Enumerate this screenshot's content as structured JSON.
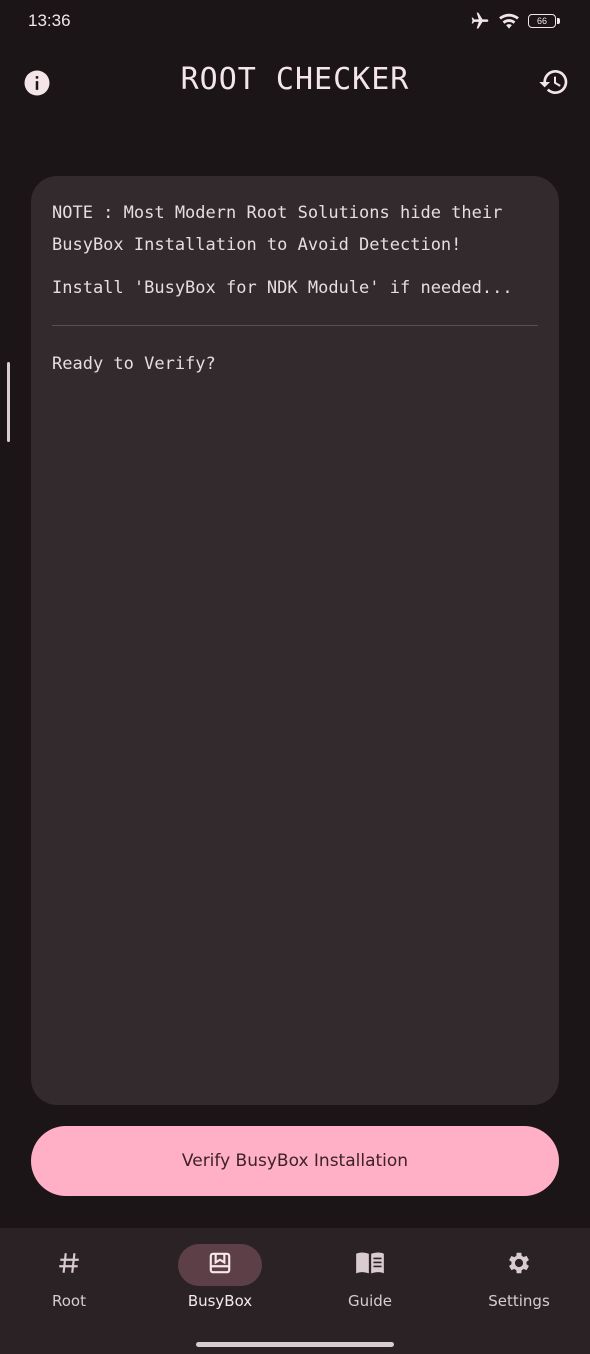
{
  "status_bar": {
    "time": "13:36",
    "icons": [
      "airplane-icon",
      "wifi-icon",
      "battery-icon"
    ],
    "battery_level": "66"
  },
  "app_bar": {
    "title": "ROOT CHECKER",
    "left_icon": "info-icon",
    "right_icon": "history-icon"
  },
  "card": {
    "note": "NOTE : Most Modern Root Solutions hide their BusyBox Installation to Avoid Detection!",
    "install_hint": "Install 'BusyBox for NDK Module' if needed...",
    "status": "Ready to Verify?"
  },
  "verify_button": {
    "label": "Verify BusyBox Installation"
  },
  "bottom_nav": {
    "items": [
      {
        "label": "Root",
        "icon": "hash-icon",
        "active": false
      },
      {
        "label": "BusyBox",
        "icon": "bookmark-box-icon",
        "active": true
      },
      {
        "label": "Guide",
        "icon": "book-open-icon",
        "active": false
      },
      {
        "label": "Settings",
        "icon": "gear-icon",
        "active": false
      }
    ]
  },
  "colors": {
    "background": "#1c1517",
    "card": "#322a2c",
    "accent": "#ffb0c6",
    "nav_background": "#2a2225",
    "nav_active_pill": "#5c3f47"
  }
}
